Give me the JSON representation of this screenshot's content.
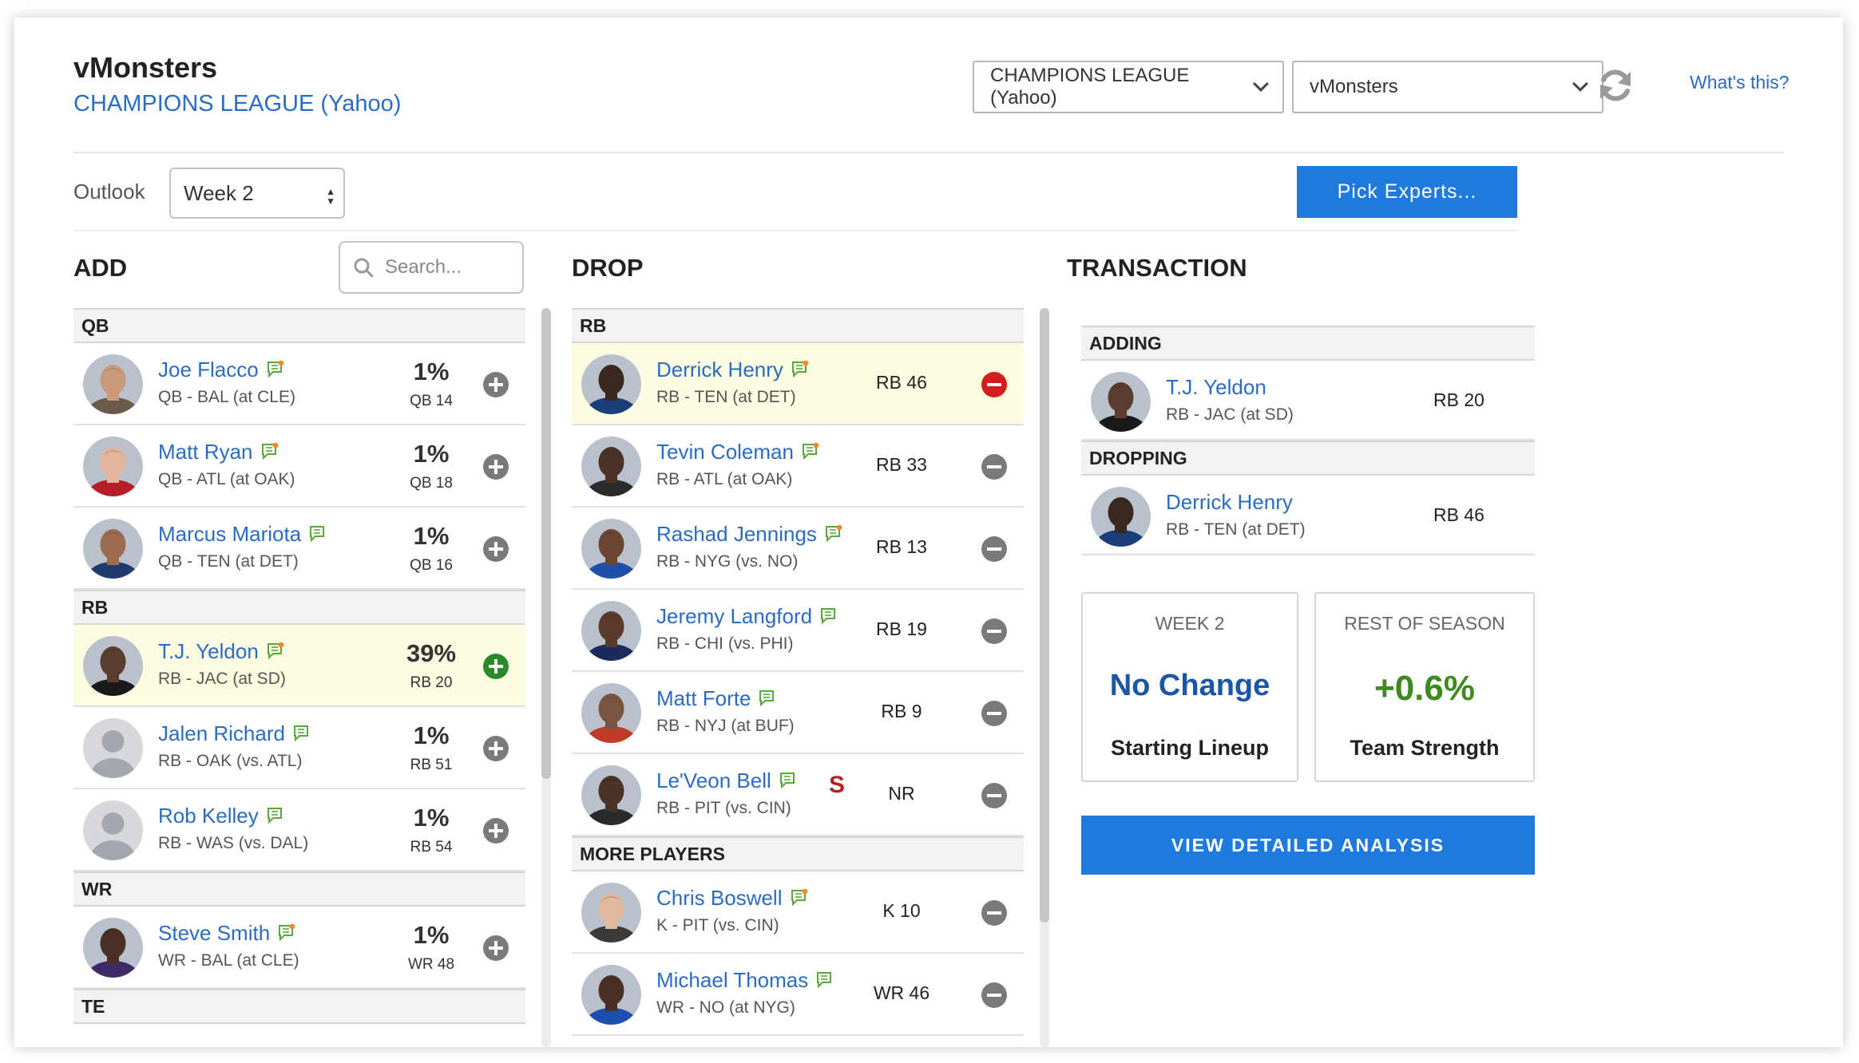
{
  "header": {
    "team_name": "vMonsters",
    "league_name": "CHAMPIONS LEAGUE (Yahoo)",
    "league_select": "CHAMPIONS LEAGUE (Yahoo)",
    "team_select": "vMonsters",
    "whats_this": "What's this?"
  },
  "outlook": {
    "label": "Outlook",
    "value": "Week 2"
  },
  "pick_experts": "Pick Experts...",
  "add": {
    "title": "ADD",
    "search_placeholder": "Search...",
    "groups": [
      {
        "label": "QB",
        "players": [
          {
            "name": "Joe Flacco",
            "info": "QB - BAL (at CLE)",
            "pct": "1%",
            "pos": "QB 14",
            "selected": false,
            "note": "new",
            "skin": "#c99a7a",
            "jersey": "#6b5a4a"
          },
          {
            "name": "Matt Ryan",
            "info": "QB - ATL (at OAK)",
            "pct": "1%",
            "pos": "QB 18",
            "selected": false,
            "note": "new",
            "skin": "#e2b59a",
            "jersey": "#b51f2a"
          },
          {
            "name": "Marcus Mariota",
            "info": "QB - TEN (at DET)",
            "pct": "1%",
            "pos": "QB 16",
            "selected": false,
            "note": "plain",
            "skin": "#9c6c4e",
            "jersey": "#1f3b6e"
          }
        ]
      },
      {
        "label": "RB",
        "players": [
          {
            "name": "T.J. Yeldon",
            "info": "RB - JAC (at SD)",
            "pct": "39%",
            "pos": "RB 20",
            "selected": true,
            "note": "new",
            "skin": "#5a3d2e",
            "jersey": "#1a1a1a"
          },
          {
            "name": "Jalen Richard",
            "info": "RB - OAK (vs. ATL)",
            "pct": "1%",
            "pos": "RB 51",
            "selected": false,
            "note": "plain",
            "skin": "",
            "jersey": ""
          },
          {
            "name": "Rob Kelley",
            "info": "RB - WAS (vs. DAL)",
            "pct": "1%",
            "pos": "RB 54",
            "selected": false,
            "note": "plain",
            "skin": "",
            "jersey": ""
          }
        ]
      },
      {
        "label": "WR",
        "players": [
          {
            "name": "Steve Smith",
            "info": "WR - BAL (at CLE)",
            "pct": "1%",
            "pos": "WR 48",
            "selected": false,
            "note": "new",
            "skin": "#4a3024",
            "jersey": "#3d2a66"
          }
        ]
      },
      {
        "label": "TE",
        "players": []
      }
    ]
  },
  "drop": {
    "title": "DROP",
    "groups": [
      {
        "label": "RB",
        "players": [
          {
            "name": "Derrick Henry",
            "info": "RB - TEN (at DET)",
            "rank": "RB 46",
            "selected": true,
            "note": "new",
            "flag": "",
            "skin": "#3b2820",
            "jersey": "#1a3e7a"
          },
          {
            "name": "Tevin Coleman",
            "info": "RB - ATL (at OAK)",
            "rank": "RB 33",
            "selected": false,
            "note": "new",
            "flag": "",
            "skin": "#4a3226",
            "jersey": "#2b2b2b"
          },
          {
            "name": "Rashad Jennings",
            "info": "RB - NYG (vs. NO)",
            "rank": "RB 13",
            "selected": false,
            "note": "new",
            "flag": "",
            "skin": "#6b4632",
            "jersey": "#1d4fa8"
          },
          {
            "name": "Jeremy Langford",
            "info": "RB - CHI (vs. PHI)",
            "rank": "RB 19",
            "selected": false,
            "note": "plain",
            "flag": "",
            "skin": "#5a3a2a",
            "jersey": "#1c2a5e"
          },
          {
            "name": "Matt Forte",
            "info": "RB - NYJ (at BUF)",
            "rank": "RB 9",
            "selected": false,
            "note": "plain",
            "flag": "",
            "skin": "#7a5440",
            "jersey": "#c03a2a"
          },
          {
            "name": "Le'Veon Bell",
            "info": "RB - PIT (vs. CIN)",
            "rank": "NR",
            "selected": false,
            "note": "plain",
            "flag": "S",
            "skin": "#4a3226",
            "jersey": "#2a2a2a"
          }
        ]
      },
      {
        "label": "MORE PLAYERS",
        "players": [
          {
            "name": "Chris Boswell",
            "info": "K - PIT (vs. CIN)",
            "rank": "K 10",
            "selected": false,
            "note": "new",
            "flag": "",
            "skin": "#e0b89c",
            "jersey": "#3a3a3a"
          },
          {
            "name": "Michael Thomas",
            "info": "WR - NO (at NYG)",
            "rank": "WR 46",
            "selected": false,
            "note": "plain",
            "flag": "",
            "skin": "#4a3024",
            "jersey": "#1c4fb0"
          }
        ]
      }
    ]
  },
  "transaction": {
    "title": "TRANSACTION",
    "adding_label": "ADDING",
    "dropping_label": "DROPPING",
    "adding": {
      "name": "T.J. Yeldon",
      "info": "RB - JAC (at SD)",
      "rank": "RB 20",
      "skin": "#5a3d2e",
      "jersey": "#1a1a1a"
    },
    "dropping": {
      "name": "Derrick Henry",
      "info": "RB - TEN (at DET)",
      "rank": "RB 46",
      "skin": "#3b2820",
      "jersey": "#1a3e7a"
    },
    "week_box": {
      "header": "WEEK 2",
      "value": "No Change",
      "footer": "Starting Lineup",
      "color": "#1a55a8"
    },
    "season_box": {
      "header": "REST OF SEASON",
      "value": "+0.6%",
      "footer": "Team Strength",
      "color": "#3d8b1e"
    },
    "analysis_button": "VIEW DETAILED ANALYSIS"
  },
  "colors": {
    "accent": "#1f7ae0",
    "link": "#2a6cc4",
    "add_selected": "#2a8a2a",
    "drop_selected": "#d41e1e",
    "highlight": "#fdfbe0"
  }
}
